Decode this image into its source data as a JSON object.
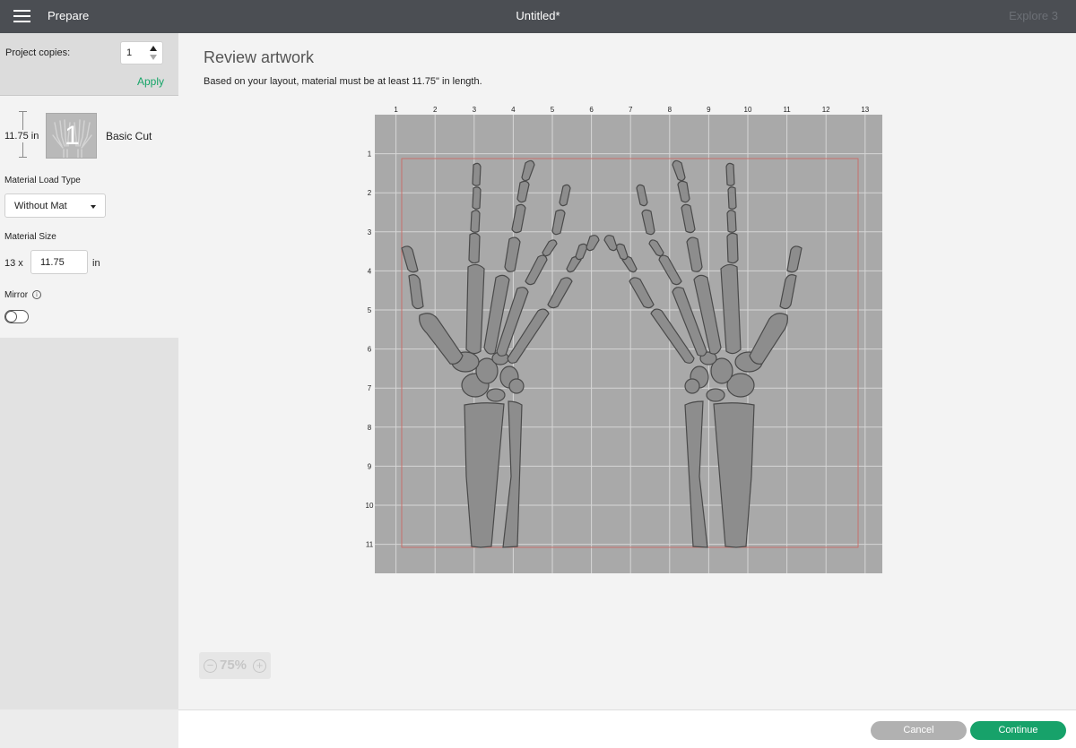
{
  "topbar": {
    "section": "Prepare",
    "title": "Untitled*",
    "machine": "Explore 3"
  },
  "sidebar": {
    "copies_label": "Project copies:",
    "copies_value": "1",
    "apply_label": "Apply",
    "mat": {
      "length": "11.75 in",
      "thumb_number": "1",
      "cut_type": "Basic Cut"
    },
    "material_load": {
      "label": "Material Load Type",
      "value": "Without Mat"
    },
    "material_size": {
      "label": "Material Size",
      "width": "13 x",
      "length_value": "11.75",
      "unit": "in"
    },
    "mirror": {
      "label": "Mirror",
      "info_icon": "i",
      "enabled": false
    }
  },
  "main": {
    "title": "Review artwork",
    "subtitle": "Based on your layout, material must be at least 11.75\" in length.",
    "ruler": {
      "x_labels": [
        "1",
        "2",
        "3",
        "4",
        "5",
        "6",
        "7",
        "8",
        "9",
        "10",
        "11",
        "12",
        "13"
      ],
      "y_labels": [
        "1",
        "2",
        "3",
        "4",
        "5",
        "6",
        "7",
        "8",
        "9",
        "10",
        "11"
      ]
    },
    "zoom": {
      "minus": "−",
      "value": "75%",
      "plus": "+"
    }
  },
  "footer": {
    "cancel_label": "Cancel",
    "continue_label": "Continue"
  },
  "colors": {
    "topbar": "#4b4e53",
    "accent_green": "#16a468",
    "mat_gray": "#a9a9a9",
    "cut_boundary": "#c8706a",
    "bone_fill": "#8d8d8d"
  }
}
